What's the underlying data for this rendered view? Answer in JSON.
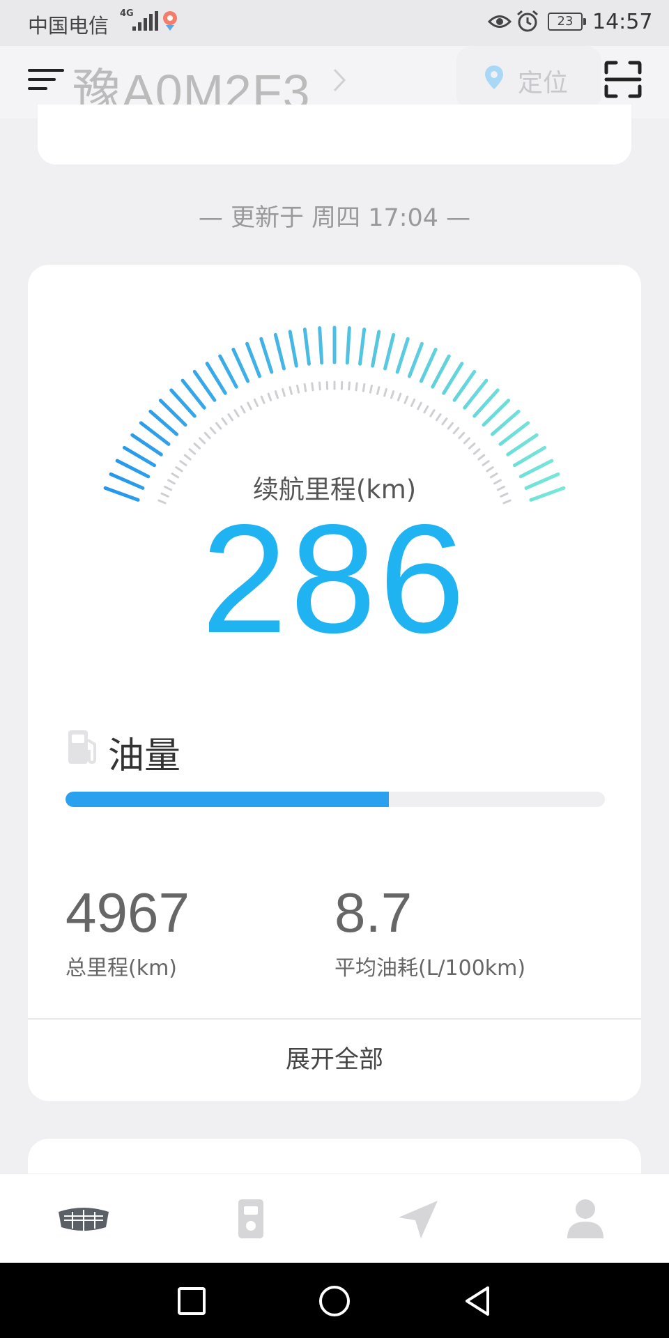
{
  "status_bar": {
    "carrier": "中国电信",
    "network": "4G",
    "battery": "23",
    "time": "14:57"
  },
  "header": {
    "plate": "豫A0M2F3",
    "locate_label": "定位"
  },
  "updated_text": "— 更新于 周四 17:04 —",
  "range": {
    "label": "续航里程(km)",
    "value": "286"
  },
  "fuel": {
    "label": "油量",
    "level_percent": 60
  },
  "stats": {
    "total_mileage": {
      "value": "4967",
      "label": "总里程(km)"
    },
    "avg_consumption": {
      "value": "8.7",
      "label": "平均油耗(L/100km)"
    }
  },
  "expand_label": "展开全部",
  "colors": {
    "accent_blue": "#1fb3f2",
    "fuel_bar": "#2aa1ef",
    "gauge_start": "#1e90ee",
    "gauge_end": "#7eeed6"
  },
  "tabs": [
    {
      "icon": "car-logo-icon",
      "active": true
    },
    {
      "icon": "car-key-icon",
      "active": false
    },
    {
      "icon": "navigation-arrow-icon",
      "active": false
    },
    {
      "icon": "user-icon",
      "active": false
    }
  ],
  "nav_buttons": [
    "recent-apps-icon",
    "home-icon",
    "back-icon"
  ]
}
